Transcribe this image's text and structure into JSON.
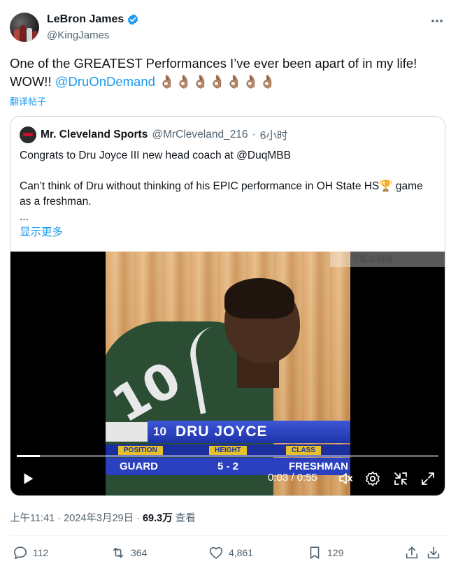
{
  "author": {
    "display_name": "LeBron James",
    "handle": "@KingJames",
    "verified": true,
    "verified_color": "#1d9bf0"
  },
  "tweet": {
    "text_before": "One of the GREATEST Performances I’ve ever been apart of in my life! WOW!! ",
    "mention": "@DruOnDemand",
    "emojis": "👌🏽👌🏽👌🏽👌🏽👌🏽👌🏽👌🏽",
    "translate_label": "翻译帖子"
  },
  "quote": {
    "display_name": "Mr. Cleveland Sports",
    "handle": "@MrCleveland_216",
    "separator": "·",
    "time": "6小时",
    "line1": "Congrats to Dru Joyce III new head coach at @DuqMBB",
    "line2": "Can’t think of Dru without thinking of his EPIC performance in OH State HS🏆 game as a freshman.",
    "line3": "...",
    "show_more": "显示更多"
  },
  "video": {
    "watermark": "下载该视频",
    "lower_third": {
      "number": "10",
      "name": "DRU JOYCE",
      "labels": [
        "POSITION",
        "HEIGHT",
        "CLASS"
      ],
      "values": [
        "GUARD",
        "5 - 2",
        "FRESHMAN"
      ]
    },
    "current_time": "0:03",
    "duration": "0:55",
    "time_display": "0:03 / 0:55",
    "progress_fraction": 0.055
  },
  "meta": {
    "time": "上午11:41",
    "date": "2024年3月29日",
    "dot": "·",
    "views": "69.3万",
    "views_label": "查看"
  },
  "actions": {
    "replies": "112",
    "reposts": "364",
    "likes": "4,861",
    "bookmarks": "129"
  },
  "colors": {
    "text": "#0f1419",
    "secondary": "#536471",
    "accent": "#1d9bf0",
    "border": "#cfd9de"
  },
  "icons": [
    "verified-badge-icon",
    "more-icon",
    "play-icon",
    "volume-icon",
    "settings-icon",
    "exit-fullscreen-icon",
    "fullscreen-icon",
    "reply-icon",
    "repost-icon",
    "like-icon",
    "bookmark-icon",
    "share-icon",
    "download-icon"
  ]
}
